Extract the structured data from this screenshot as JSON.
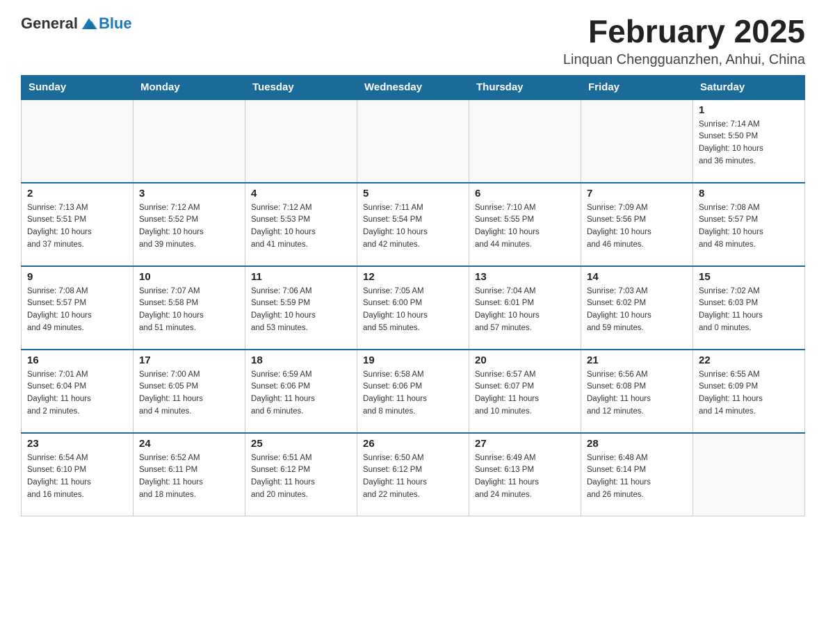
{
  "header": {
    "logo": {
      "general": "General",
      "blue": "Blue"
    },
    "title": "February 2025",
    "location": "Linquan Chengguanzhen, Anhui, China"
  },
  "weekdays": [
    "Sunday",
    "Monday",
    "Tuesday",
    "Wednesday",
    "Thursday",
    "Friday",
    "Saturday"
  ],
  "weeks": [
    [
      {
        "day": "",
        "info": ""
      },
      {
        "day": "",
        "info": ""
      },
      {
        "day": "",
        "info": ""
      },
      {
        "day": "",
        "info": ""
      },
      {
        "day": "",
        "info": ""
      },
      {
        "day": "",
        "info": ""
      },
      {
        "day": "1",
        "info": "Sunrise: 7:14 AM\nSunset: 5:50 PM\nDaylight: 10 hours\nand 36 minutes."
      }
    ],
    [
      {
        "day": "2",
        "info": "Sunrise: 7:13 AM\nSunset: 5:51 PM\nDaylight: 10 hours\nand 37 minutes."
      },
      {
        "day": "3",
        "info": "Sunrise: 7:12 AM\nSunset: 5:52 PM\nDaylight: 10 hours\nand 39 minutes."
      },
      {
        "day": "4",
        "info": "Sunrise: 7:12 AM\nSunset: 5:53 PM\nDaylight: 10 hours\nand 41 minutes."
      },
      {
        "day": "5",
        "info": "Sunrise: 7:11 AM\nSunset: 5:54 PM\nDaylight: 10 hours\nand 42 minutes."
      },
      {
        "day": "6",
        "info": "Sunrise: 7:10 AM\nSunset: 5:55 PM\nDaylight: 10 hours\nand 44 minutes."
      },
      {
        "day": "7",
        "info": "Sunrise: 7:09 AM\nSunset: 5:56 PM\nDaylight: 10 hours\nand 46 minutes."
      },
      {
        "day": "8",
        "info": "Sunrise: 7:08 AM\nSunset: 5:57 PM\nDaylight: 10 hours\nand 48 minutes."
      }
    ],
    [
      {
        "day": "9",
        "info": "Sunrise: 7:08 AM\nSunset: 5:57 PM\nDaylight: 10 hours\nand 49 minutes."
      },
      {
        "day": "10",
        "info": "Sunrise: 7:07 AM\nSunset: 5:58 PM\nDaylight: 10 hours\nand 51 minutes."
      },
      {
        "day": "11",
        "info": "Sunrise: 7:06 AM\nSunset: 5:59 PM\nDaylight: 10 hours\nand 53 minutes."
      },
      {
        "day": "12",
        "info": "Sunrise: 7:05 AM\nSunset: 6:00 PM\nDaylight: 10 hours\nand 55 minutes."
      },
      {
        "day": "13",
        "info": "Sunrise: 7:04 AM\nSunset: 6:01 PM\nDaylight: 10 hours\nand 57 minutes."
      },
      {
        "day": "14",
        "info": "Sunrise: 7:03 AM\nSunset: 6:02 PM\nDaylight: 10 hours\nand 59 minutes."
      },
      {
        "day": "15",
        "info": "Sunrise: 7:02 AM\nSunset: 6:03 PM\nDaylight: 11 hours\nand 0 minutes."
      }
    ],
    [
      {
        "day": "16",
        "info": "Sunrise: 7:01 AM\nSunset: 6:04 PM\nDaylight: 11 hours\nand 2 minutes."
      },
      {
        "day": "17",
        "info": "Sunrise: 7:00 AM\nSunset: 6:05 PM\nDaylight: 11 hours\nand 4 minutes."
      },
      {
        "day": "18",
        "info": "Sunrise: 6:59 AM\nSunset: 6:06 PM\nDaylight: 11 hours\nand 6 minutes."
      },
      {
        "day": "19",
        "info": "Sunrise: 6:58 AM\nSunset: 6:06 PM\nDaylight: 11 hours\nand 8 minutes."
      },
      {
        "day": "20",
        "info": "Sunrise: 6:57 AM\nSunset: 6:07 PM\nDaylight: 11 hours\nand 10 minutes."
      },
      {
        "day": "21",
        "info": "Sunrise: 6:56 AM\nSunset: 6:08 PM\nDaylight: 11 hours\nand 12 minutes."
      },
      {
        "day": "22",
        "info": "Sunrise: 6:55 AM\nSunset: 6:09 PM\nDaylight: 11 hours\nand 14 minutes."
      }
    ],
    [
      {
        "day": "23",
        "info": "Sunrise: 6:54 AM\nSunset: 6:10 PM\nDaylight: 11 hours\nand 16 minutes."
      },
      {
        "day": "24",
        "info": "Sunrise: 6:52 AM\nSunset: 6:11 PM\nDaylight: 11 hours\nand 18 minutes."
      },
      {
        "day": "25",
        "info": "Sunrise: 6:51 AM\nSunset: 6:12 PM\nDaylight: 11 hours\nand 20 minutes."
      },
      {
        "day": "26",
        "info": "Sunrise: 6:50 AM\nSunset: 6:12 PM\nDaylight: 11 hours\nand 22 minutes."
      },
      {
        "day": "27",
        "info": "Sunrise: 6:49 AM\nSunset: 6:13 PM\nDaylight: 11 hours\nand 24 minutes."
      },
      {
        "day": "28",
        "info": "Sunrise: 6:48 AM\nSunset: 6:14 PM\nDaylight: 11 hours\nand 26 minutes."
      },
      {
        "day": "",
        "info": ""
      }
    ]
  ]
}
